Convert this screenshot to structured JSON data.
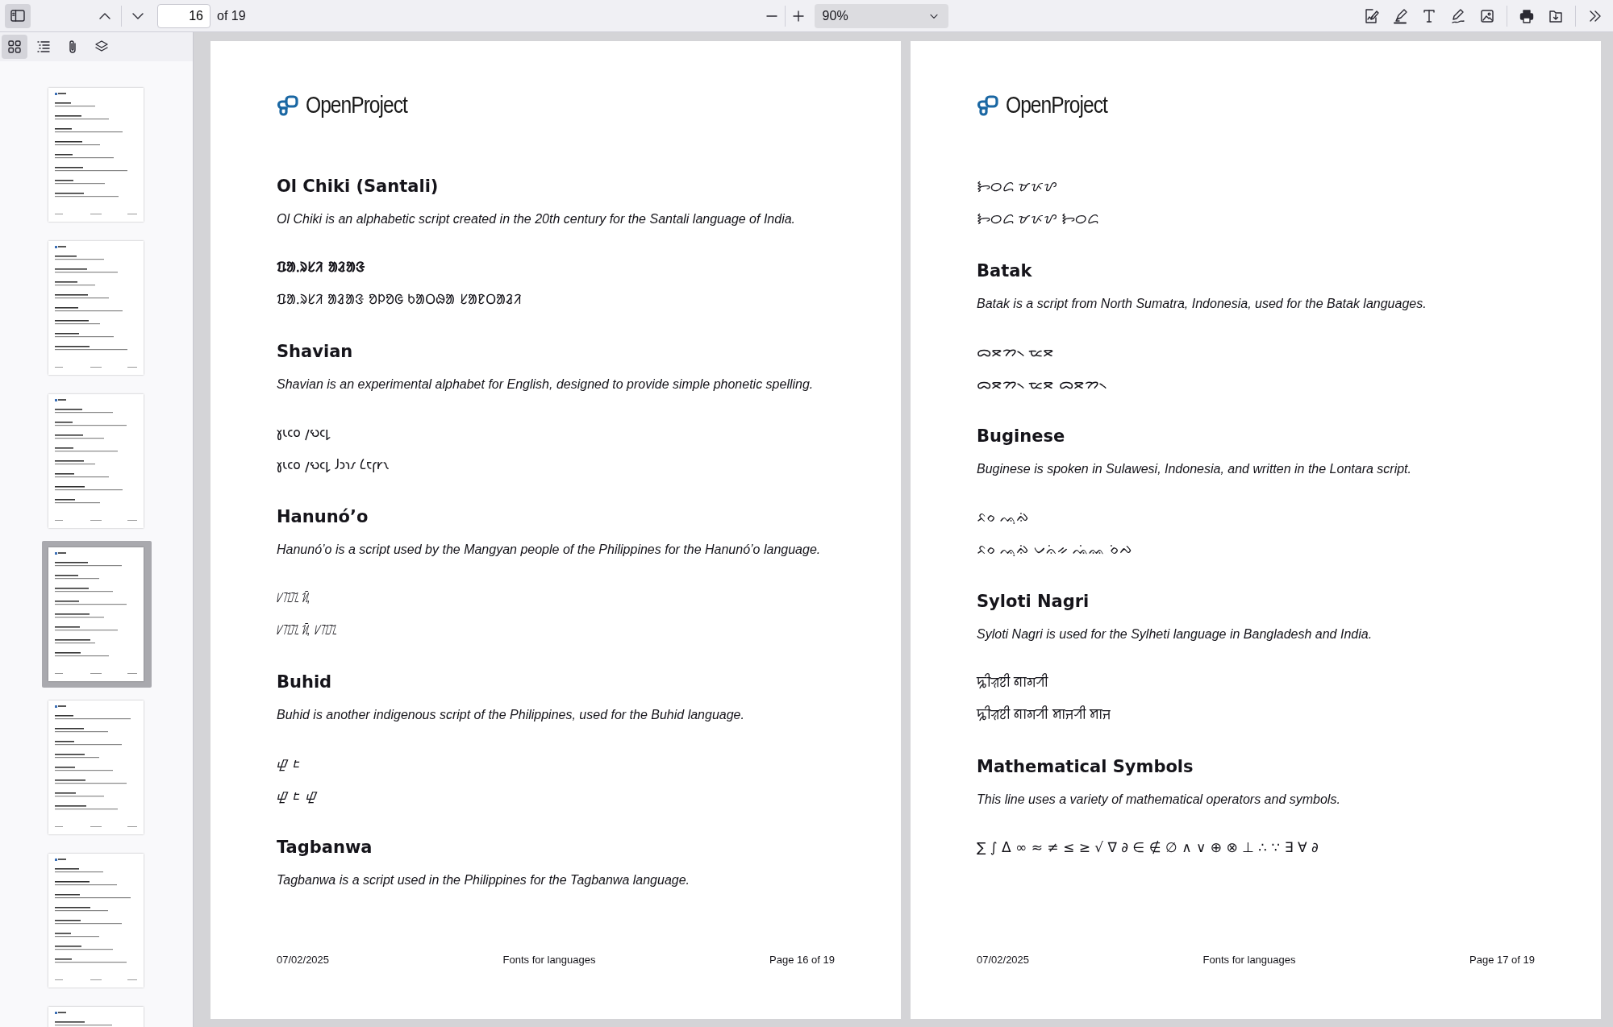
{
  "toolbar": {
    "sidebar_toggle": {
      "selected": true
    },
    "page_number": "16",
    "page_count": "of 19",
    "zoom": "90%",
    "tools": [
      {
        "kind": "signature"
      },
      {
        "kind": "highlight"
      },
      {
        "kind": "text"
      },
      {
        "kind": "draw"
      },
      {
        "kind": "image"
      },
      {
        "kind": "print"
      },
      {
        "kind": "save"
      },
      {
        "kind": "more"
      }
    ]
  },
  "sidebar_tabs": [
    {
      "kind": "thumbnails",
      "selected": true
    },
    {
      "kind": "outline",
      "selected": false
    },
    {
      "kind": "attachments",
      "selected": false
    },
    {
      "kind": "layers",
      "selected": false
    }
  ],
  "thumbnails": [
    {
      "selected": false
    },
    {
      "selected": false
    },
    {
      "selected": false
    },
    {
      "selected": true
    },
    {
      "selected": false
    },
    {
      "selected": false
    },
    {
      "selected": false
    }
  ],
  "pages": [
    {
      "logo": "OpenProject",
      "blocks": [
        {
          "kind": "heading",
          "text": "Ol Chiki (Santali)"
        },
        {
          "kind": "description",
          "text": "Ol Chiki is an alphabetic script created in the 20th century for the Santali language of India."
        },
        {
          "kind": "sample",
          "text": "ᱯᱟᱹᱨᱥᱤ ᱟᱲᱟᱝ",
          "bold": true
        },
        {
          "kind": "sample",
          "text": "ᱯᱟᱹᱨᱥᱤ ᱟᱲᱟᱝ ᱚᱞᱚᱜ ᱠᱟᱛᱷᱟ ᱥᱟᱱᱛᱟᱲᱤ",
          "bold": false
        },
        {
          "kind": "heading",
          "text": "Shavian"
        },
        {
          "kind": "description",
          "text": "Shavian is an experimental alphabet for English, designed to provide simple phonetic spelling."
        },
        {
          "kind": "sample",
          "text": "𐑣𐑧𐑤𐑴 𐑢𐑻𐑤𐑛",
          "bold": false
        },
        {
          "kind": "sample",
          "text": "𐑣𐑧𐑤𐑴 𐑢𐑻𐑤𐑛 𐑓𐑮𐑪𐑥 𐑖𐑱𐑝𐑾𐑯",
          "bold": false
        },
        {
          "kind": "heading",
          "text": "Hanunó’o"
        },
        {
          "kind": "description",
          "text": "Hanunó’o is a script used by the Mangyan people of the Philippines for the Hanunó’o language."
        },
        {
          "kind": "sample",
          "text": "ᜱᜨᜳᜨᜳ ᜰᜲ",
          "bold": false
        },
        {
          "kind": "sample",
          "text": "ᜱᜨᜳᜨᜳ ᜰᜲ ᜱᜨᜳᜨᜳ",
          "bold": false
        },
        {
          "kind": "heading",
          "text": "Buhid"
        },
        {
          "kind": "description",
          "text": "Buhid is another indigenous script of the Philippines, used for the Buhid language."
        },
        {
          "kind": "sample",
          "text": "ᝎᝓ ᝑᝒ",
          "bold": false
        },
        {
          "kind": "sample",
          "text": "ᝎᝓ ᝑᝒ ᝎᝓ",
          "bold": false
        },
        {
          "kind": "heading",
          "text": "Tagbanwa"
        },
        {
          "kind": "description",
          "text": "Tagbanwa is a script used in the Philippines for the Tagbanwa language."
        }
      ],
      "footer": {
        "date": "07/02/2025",
        "title": "Fonts for languages",
        "page": "Page 16 of 19"
      }
    },
    {
      "logo": "OpenProject",
      "blocks": [
        {
          "kind": "sample",
          "text": "ᝦᝪᝯ ᝫᝩᝬ",
          "bold": false
        },
        {
          "kind": "sample",
          "text": "ᝦᝪᝯ ᝫᝩᝬ ᝦᝪᝯ",
          "bold": false
        },
        {
          "kind": "heading",
          "text": "Batak"
        },
        {
          "kind": "description",
          "text": "Batak is a script from North Sumatra, Indonesia, used for the Batak languages."
        },
        {
          "kind": "sample",
          "text": "ᯅᯖᯂ᯲ ᯔᯖ",
          "bold": false
        },
        {
          "kind": "sample",
          "text": "ᯅᯖᯂ᯲ ᯔᯖ ᯅᯖᯂ᯲",
          "bold": false
        },
        {
          "kind": "heading",
          "text": "Buginese"
        },
        {
          "kind": "description",
          "text": "Buginese is spoken in Sulawesi, Indonesia, and written in the Lontara script."
        },
        {
          "kind": "sample",
          "text": "ᨅᨔ ᨕᨘᨁᨗ",
          "bold": false
        },
        {
          "kind": "sample",
          "text": "ᨅᨔ ᨕᨘᨁᨗ ᨆᨊᨗᨀ ᨕᨗᨐ ᨔᨗᨄ",
          "bold": false
        },
        {
          "kind": "heading",
          "text": "Syloti Nagri"
        },
        {
          "kind": "description",
          "text": "Syloti Nagri is used for the Sylheti language in Bangladesh and India."
        },
        {
          "kind": "sample",
          "text": "ꠍꠤꠟꠐꠤ ꠘꠣꠉꠞꠤ",
          "bold": false
        },
        {
          "kind": "sample",
          "text": "ꠍꠤꠟꠐꠤ ꠘꠣꠉꠞꠤ ꠝꠣꠔꠞꠤ ꠝꠣꠔ",
          "bold": false
        },
        {
          "kind": "heading",
          "text": "Mathematical Symbols"
        },
        {
          "kind": "description",
          "text": "This line uses a variety of mathematical operators and symbols."
        },
        {
          "kind": "sample",
          "text": "∑ ∫ Δ ∞ ≈ ≠ ≤ ≥ √ ∇ ∂ ∈ ∉ ∅ ∧ ∨ ⊕ ⊗ ⊥ ∴ ∵ ∃ ∀ ∂",
          "bold": false
        }
      ],
      "footer": {
        "date": "07/02/2025",
        "title": "Fonts for languages",
        "page": "Page 17 of 19"
      }
    }
  ]
}
